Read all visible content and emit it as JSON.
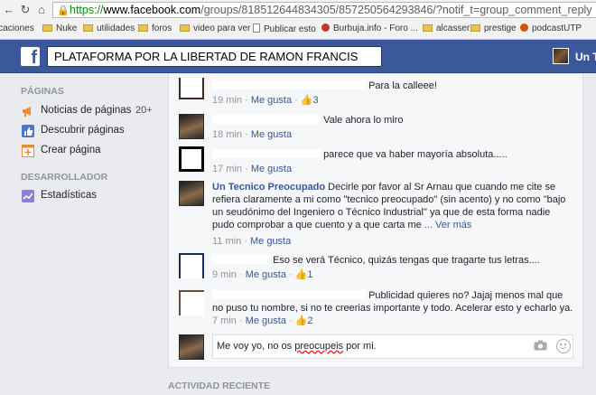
{
  "browser": {
    "url_scheme": "https://",
    "url_host": "www.facebook.com",
    "url_rest": "/groups/818512644834305/857250564293846/?notif_t=group_comment_reply",
    "bookmarks": [
      "icaciones",
      "Nuke",
      "utilidades",
      "foros",
      "video para ver",
      "Publicar esto",
      "Burbuja.info - Foro ...",
      "alcasser",
      "prestige",
      "podcastUTP"
    ]
  },
  "fb": {
    "search_value": "PLATAFORMA POR LA LIBERTAD DE RAMON FRANCIS",
    "profile_name": "Un T"
  },
  "sidebar": {
    "pages_heading": "PÁGINAS",
    "items": [
      {
        "label": "Noticias de páginas",
        "count": "20+"
      },
      {
        "label": "Descubrir páginas"
      },
      {
        "label": "Crear página"
      }
    ],
    "dev_heading": "DESARROLLADOR",
    "dev_items": [
      {
        "label": "Estadísticas"
      }
    ]
  },
  "comments": [
    {
      "text": "Para la calleee!",
      "time": "19 min",
      "like": "Me gusta",
      "likes": "3"
    },
    {
      "text": "Vale ahora lo miro",
      "time": "18 min",
      "like": "Me gusta"
    },
    {
      "text": "parece que va haber mayoría absoluta.....",
      "time": "17 min",
      "like": "Me gusta"
    },
    {
      "author": "Un Tecnico Preocupado",
      "text": "Decirle por favor al Sr Arnau que cuando me cite se refiera claramente a mi como \"tecnico preocupado\" (sin acento) y no como \"bajo un seudónimo del Ingeniero o Técnico Industrial\" ya que de esta forma nadie pudo comprobar a que cuento y a que carta me",
      "see_more": "... Ver más",
      "time": "11 min",
      "like": "Me gusta"
    },
    {
      "text": "Eso se verá Técnico, quizás tengas que tragarte tus letras....",
      "time": "9 min",
      "like": "Me gusta",
      "likes": "1"
    },
    {
      "text": "Publicidad quieres no? Jajaj menos mal que no puso tu nombre, si no te creerias importante y todo. Acelerar esto y echarlo ya.",
      "time": "7 min",
      "like": "Me gusta",
      "likes": "2"
    }
  ],
  "composer": {
    "text_before": "Me voy yo, no os ",
    "text_misspelled": "preocupeis",
    "text_after": " por mi."
  },
  "activity_heading": "ACTIVIDAD RECIENTE"
}
